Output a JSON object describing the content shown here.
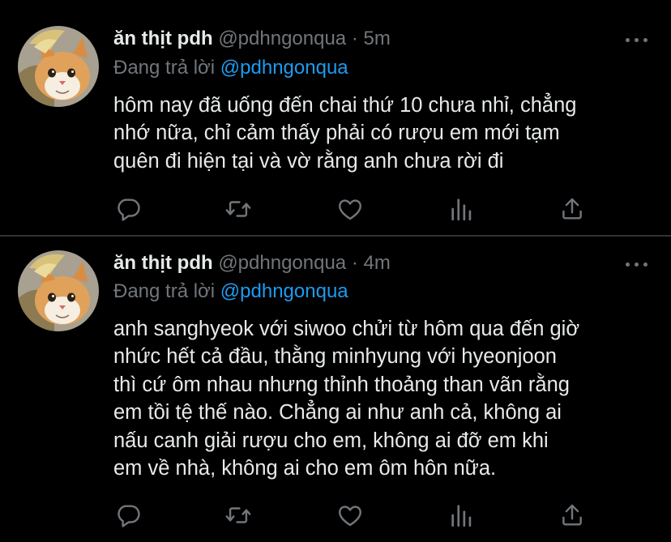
{
  "tweets": [
    {
      "author_name": "ăn thịt pdh",
      "handle": "@pdhngonqua",
      "separator": "·",
      "time": "5m",
      "reply_prefix": "Đang trả lời",
      "reply_to": "@pdhngonqua",
      "text_lines": [
        "hôm nay đã uống đến chai thứ 10 chưa nhỉ, chẳng",
        "nhớ nữa, chỉ cảm thấy phải có rượu em mới tạm",
        "quên đi hiện tại và vờ rằng anh chưa rời đi"
      ]
    },
    {
      "author_name": "ăn thịt pdh",
      "handle": "@pdhngonqua",
      "separator": "·",
      "time": "4m",
      "reply_prefix": "Đang trả lời",
      "reply_to": "@pdhngonqua",
      "text_lines": [
        "anh sanghyeok với siwoo chửi từ hôm qua đến giờ",
        "nhức hết cả đầu, thằng minhyung với hyeonjoon",
        "thì cứ ôm nhau nhưng thỉnh thoảng than vãn rằng",
        "em tồi tệ thế nào. Chẳng ai như anh cả, không ai",
        "nấu canh giải rượu cho em, không ai đỡ em khi",
        "em về nhà, không ai cho em ôm hôn nữa."
      ]
    }
  ],
  "icons": [
    "reply-icon",
    "retweet-icon",
    "like-icon",
    "analytics-icon",
    "share-icon",
    "more-icon"
  ],
  "colors": {
    "background": "#000000",
    "text_primary": "#e7e9ea",
    "text_secondary": "#71767b",
    "accent": "#1d9bf0",
    "divider": "#2f3336"
  }
}
